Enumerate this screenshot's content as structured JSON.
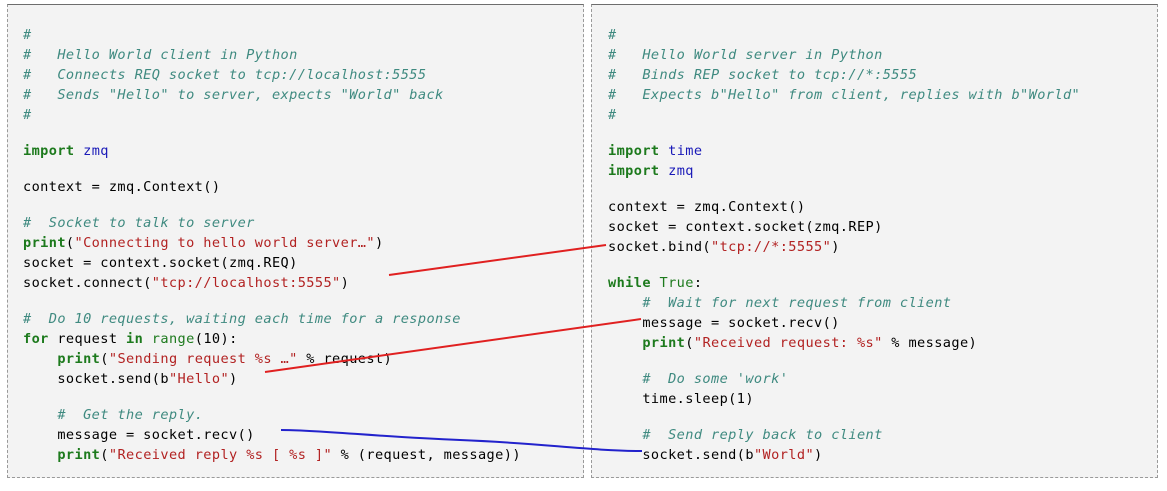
{
  "colors": {
    "comment": "#3f8a80",
    "keyword": "#1d7a1d",
    "builtin": "#1d7a1d",
    "module": "#1a1ab8",
    "string": "#b22222",
    "text": "#000000",
    "number": "#000000",
    "connector_red": "#e02020",
    "connector_blue": "#2222cc"
  },
  "client": {
    "lines": [
      [
        {
          "t": "#",
          "k": "comment"
        }
      ],
      [
        {
          "t": "#   Hello World client in Python",
          "k": "comment"
        }
      ],
      [
        {
          "t": "#   Connects REQ socket to tcp://localhost:5555",
          "k": "comment"
        }
      ],
      [
        {
          "t": "#   Sends \"Hello\" to server, expects \"World\" back",
          "k": "comment"
        }
      ],
      [
        {
          "t": "#",
          "k": "comment"
        }
      ],
      [],
      [
        {
          "t": "import",
          "k": "keyword"
        },
        {
          "t": " "
        },
        {
          "t": "zmq",
          "k": "module"
        }
      ],
      [],
      [
        {
          "t": "context = zmq.Context()"
        }
      ],
      [],
      [
        {
          "t": "#  Socket to talk to server",
          "k": "comment"
        }
      ],
      [
        {
          "t": "print",
          "k": "keyword"
        },
        {
          "t": "("
        },
        {
          "t": "\"Connecting to hello world server…\"",
          "k": "string"
        },
        {
          "t": ")"
        }
      ],
      [
        {
          "t": "socket = context.socket(zmq.REQ)"
        }
      ],
      [
        {
          "t": "socket.connect("
        },
        {
          "t": "\"tcp://localhost:5555\"",
          "k": "string"
        },
        {
          "t": ")"
        }
      ],
      [],
      [
        {
          "t": "#  Do 10 requests, waiting each time for a response",
          "k": "comment"
        }
      ],
      [
        {
          "t": "for",
          "k": "keyword"
        },
        {
          "t": " request "
        },
        {
          "t": "in",
          "k": "keyword"
        },
        {
          "t": " "
        },
        {
          "t": "range",
          "k": "builtin"
        },
        {
          "t": "("
        },
        {
          "t": "10",
          "k": "number"
        },
        {
          "t": "):"
        }
      ],
      [
        {
          "t": "    "
        },
        {
          "t": "print",
          "k": "keyword"
        },
        {
          "t": "("
        },
        {
          "t": "\"Sending request %s …\"",
          "k": "string"
        },
        {
          "t": " % request)"
        }
      ],
      [
        {
          "t": "    socket.send(b"
        },
        {
          "t": "\"Hello\"",
          "k": "string"
        },
        {
          "t": ")"
        }
      ],
      [],
      [
        {
          "t": "    "
        },
        {
          "t": "#  Get the reply.",
          "k": "comment"
        }
      ],
      [
        {
          "t": "    message = socket.recv()"
        }
      ],
      [
        {
          "t": "    "
        },
        {
          "t": "print",
          "k": "keyword"
        },
        {
          "t": "("
        },
        {
          "t": "\"Received reply %s [ %s ]\"",
          "k": "string"
        },
        {
          "t": " % (request, message))"
        }
      ]
    ]
  },
  "server": {
    "lines": [
      [
        {
          "t": "#",
          "k": "comment"
        }
      ],
      [
        {
          "t": "#   Hello World server in Python",
          "k": "comment"
        }
      ],
      [
        {
          "t": "#   Binds REP socket to tcp://*:5555",
          "k": "comment"
        }
      ],
      [
        {
          "t": "#   Expects b\"Hello\" from client, replies with b\"World\"",
          "k": "comment"
        }
      ],
      [
        {
          "t": "#",
          "k": "comment"
        }
      ],
      [],
      [
        {
          "t": "import",
          "k": "keyword"
        },
        {
          "t": " "
        },
        {
          "t": "time",
          "k": "module"
        }
      ],
      [
        {
          "t": "import",
          "k": "keyword"
        },
        {
          "t": " "
        },
        {
          "t": "zmq",
          "k": "module"
        }
      ],
      [],
      [
        {
          "t": "context = zmq.Context()"
        }
      ],
      [
        {
          "t": "socket = context.socket(zmq.REP)"
        }
      ],
      [
        {
          "t": "socket.bind("
        },
        {
          "t": "\"tcp://*:5555\"",
          "k": "string"
        },
        {
          "t": ")"
        }
      ],
      [],
      [
        {
          "t": "while",
          "k": "keyword"
        },
        {
          "t": " "
        },
        {
          "t": "True",
          "k": "builtin"
        },
        {
          "t": ":"
        }
      ],
      [
        {
          "t": "    "
        },
        {
          "t": "#  Wait for next request from client",
          "k": "comment"
        }
      ],
      [
        {
          "t": "    message = socket.recv()"
        }
      ],
      [
        {
          "t": "    "
        },
        {
          "t": "print",
          "k": "keyword"
        },
        {
          "t": "("
        },
        {
          "t": "\"Received request: %s\"",
          "k": "string"
        },
        {
          "t": " % message)"
        }
      ],
      [],
      [
        {
          "t": "    "
        },
        {
          "t": "#  Do some 'work'",
          "k": "comment"
        }
      ],
      [
        {
          "t": "    time.sleep("
        },
        {
          "t": "1",
          "k": "number"
        },
        {
          "t": ")"
        }
      ],
      [],
      [
        {
          "t": "    "
        },
        {
          "t": "#  Send reply back to client",
          "k": "comment"
        }
      ],
      [
        {
          "t": "    socket.send(b"
        },
        {
          "t": "\"World\"",
          "k": "string"
        },
        {
          "t": ")"
        }
      ]
    ]
  }
}
